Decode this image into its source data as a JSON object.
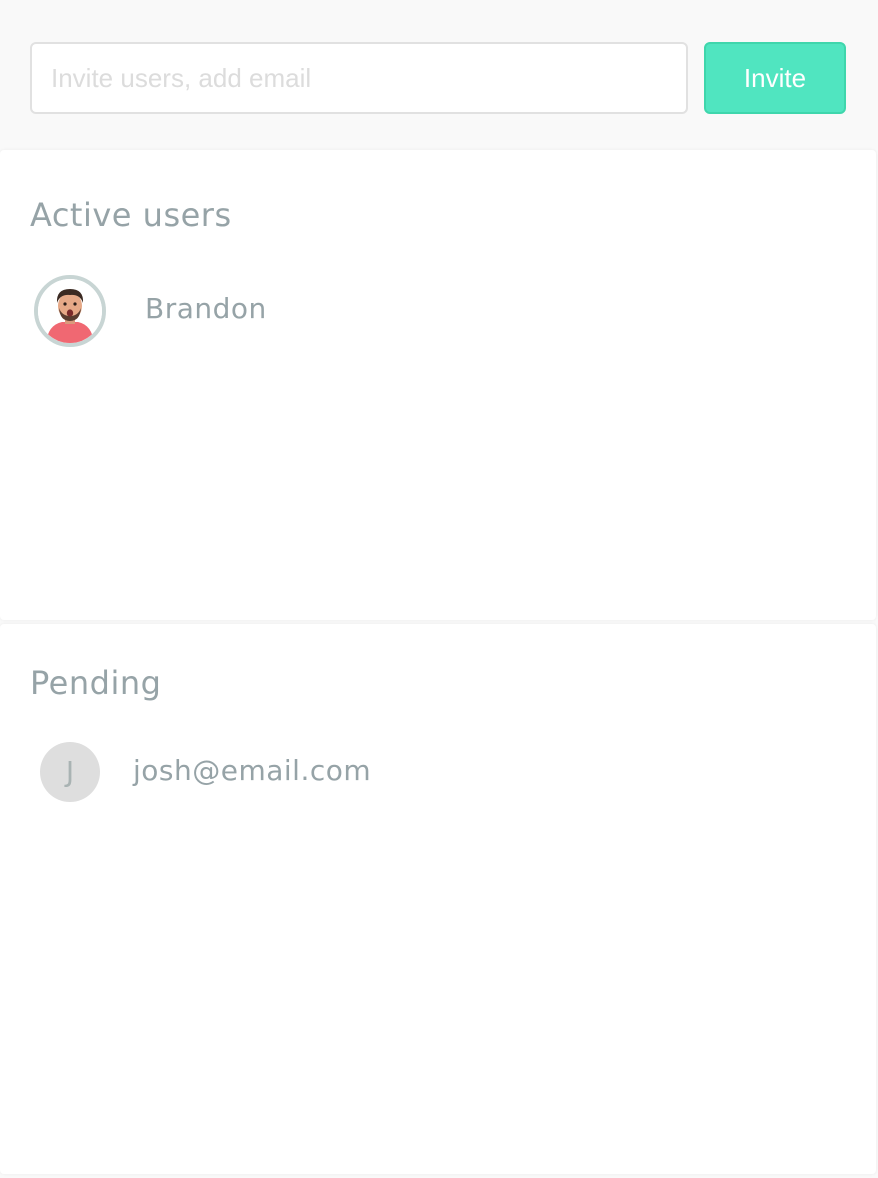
{
  "invite": {
    "placeholder": "Invite users, add email",
    "value": "",
    "button_label": "Invite"
  },
  "active_users": {
    "title": "Active users",
    "users": [
      {
        "name": "Brandon",
        "avatar_icon": "user-photo-avatar"
      }
    ]
  },
  "pending": {
    "title": "Pending",
    "users": [
      {
        "initial": "J",
        "email": "josh@email.com"
      }
    ]
  },
  "colors": {
    "accent": "#50e5c0",
    "accent_border": "#3fd6ac",
    "muted_text": "#96a3a7",
    "avatar_ring": "#c8d5d4",
    "initial_bg": "#dedede"
  }
}
